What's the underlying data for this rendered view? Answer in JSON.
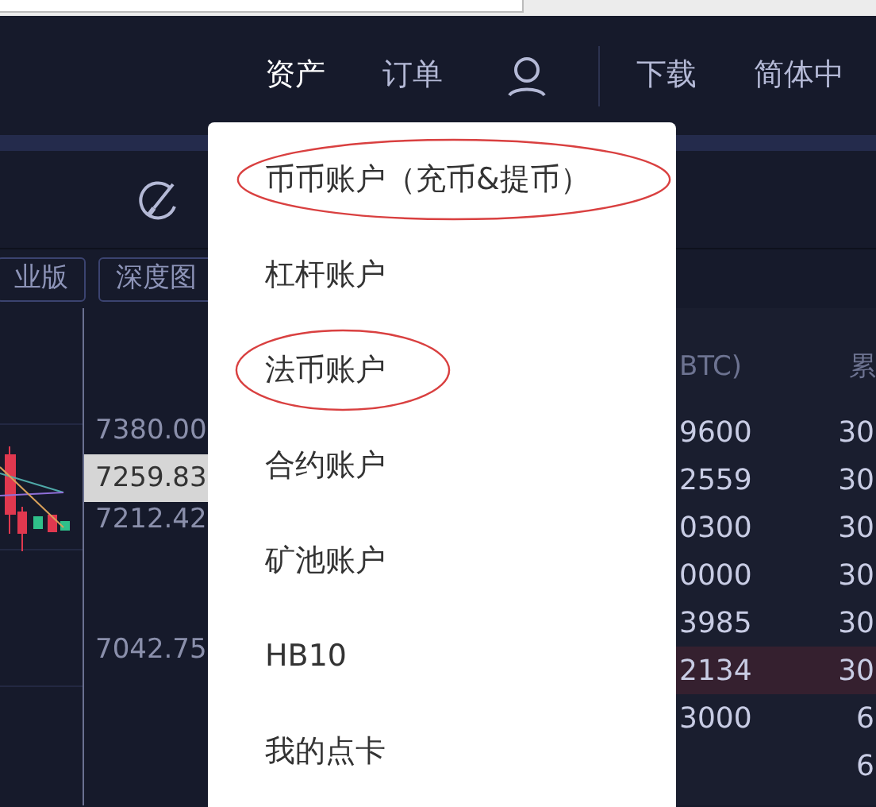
{
  "nav": {
    "items": [
      {
        "label": "资产",
        "selected": true
      },
      {
        "label": "订单",
        "selected": false
      }
    ],
    "right_items": [
      "下载",
      "简体中"
    ]
  },
  "chart_tabs": [
    "业版",
    "深度图"
  ],
  "price_axis": [
    {
      "label": "7380.00",
      "current": false
    },
    {
      "label": "7259.83",
      "current": true
    },
    {
      "label": "7212.42",
      "current": false
    },
    {
      "label": "7042.75",
      "current": false
    }
  ],
  "order_book": {
    "column_1": "BTC)",
    "column_2": "累",
    "rows": [
      {
        "amount": "9600",
        "total": "30",
        "highlighted": false
      },
      {
        "amount": "2559",
        "total": "30",
        "highlighted": false
      },
      {
        "amount": "0300",
        "total": "30",
        "highlighted": false
      },
      {
        "amount": "0000",
        "total": "30",
        "highlighted": false
      },
      {
        "amount": "3985",
        "total": "30",
        "highlighted": false
      },
      {
        "amount": "2134",
        "total": "30",
        "highlighted": true
      },
      {
        "amount": "3000",
        "total": "6",
        "highlighted": false
      },
      {
        "total": "6",
        "highlighted": false
      }
    ]
  },
  "dropdown": {
    "items": [
      {
        "label": "币币账户（充币&提币）",
        "circled": true
      },
      {
        "label": "杠杆账户",
        "circled": false
      },
      {
        "label": "法币账户",
        "circled": true
      },
      {
        "label": "合约账户",
        "circled": false
      },
      {
        "label": "矿池账户",
        "circled": false
      },
      {
        "label": "HB10",
        "circled": false
      },
      {
        "label": "我的点卡",
        "circled": false
      }
    ]
  }
}
